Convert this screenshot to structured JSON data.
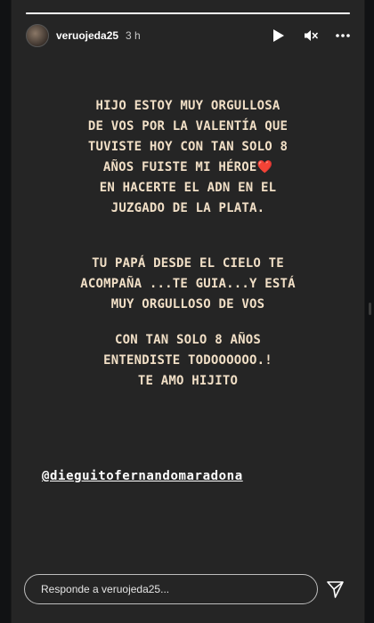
{
  "story": {
    "progress": 1.0,
    "username": "veruojeda25",
    "time": "3 h",
    "icons": [
      "play-icon",
      "mute-icon",
      "more-icon",
      "send-icon"
    ],
    "message": {
      "p1": [
        "HIJO ESTOY MUY ORGULLOSA",
        "DE VOS POR LA VALENTÍA QUE",
        "TUVISTE HOY CON TAN SOLO 8",
        "AÑOS FUISTE MI HÉROE",
        "EN HACERTE EL ADN EN EL",
        "JUZGADO DE LA PLATA."
      ],
      "heart": "❤️",
      "p2": [
        "TU PAPÁ DESDE EL CIELO TE",
        "ACOMPAÑA ...TE GUIA...Y ESTÁ",
        "MUY ORGULLOSO DE VOS"
      ],
      "p3": [
        "CON TAN SOLO 8 AÑOS",
        "ENTENDISTE TODOOOOOO.!",
        "TE AMO HIJITO"
      ]
    },
    "mention": "@dieguitofernandomaradona",
    "reply_placeholder": "Responde a veruojeda25..."
  },
  "colors": {
    "story_bg": "#252525",
    "page_bg": "#111214",
    "text": "#f1dfc6",
    "heart": "#e0245e"
  }
}
